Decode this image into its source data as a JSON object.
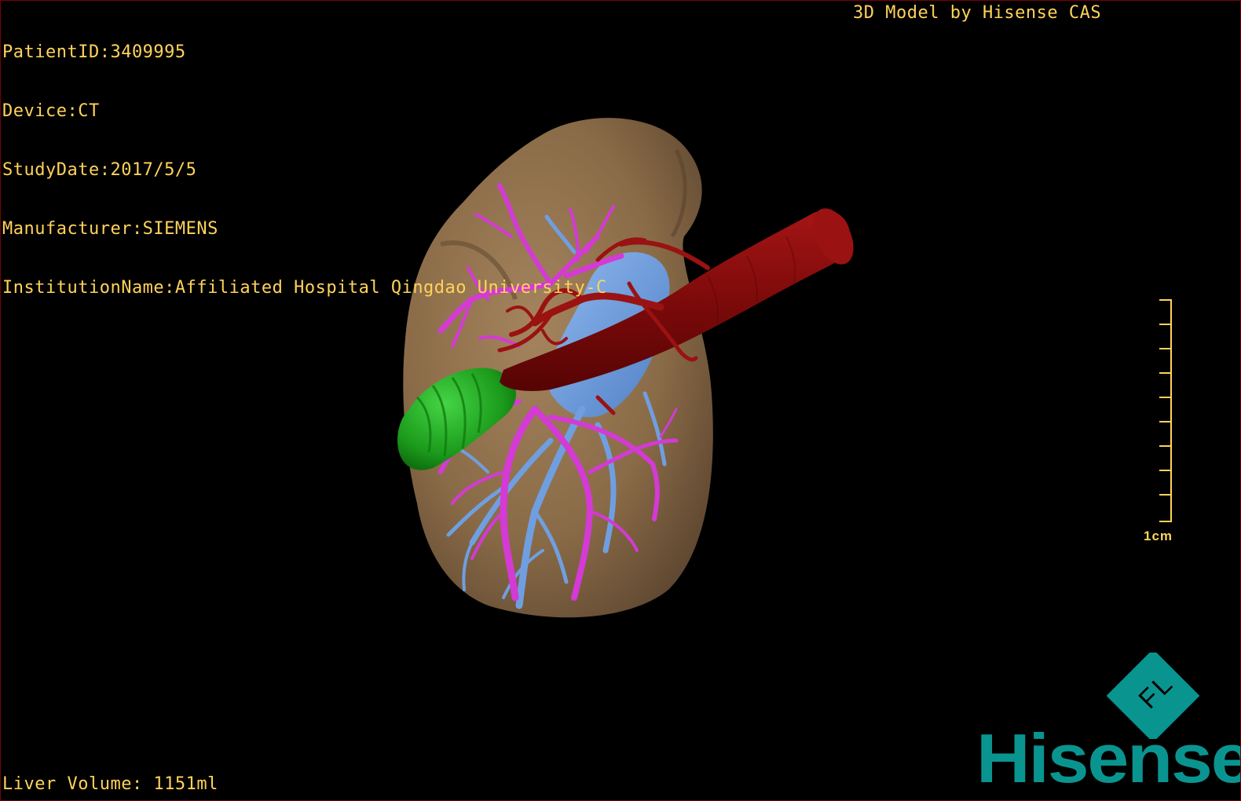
{
  "overlay": {
    "info_lines": [
      "PatientID:3409995",
      "Device:CT",
      "StudyDate:2017/5/5",
      "Manufacturer:SIEMENS",
      "InstitutionName:Affiliated Hospital Qingdao University-C"
    ],
    "model_credit": "3D Model by Hisense CAS",
    "liver_volume": "Liver Volume: 1151ml",
    "scale_label": "1cm"
  },
  "logo": {
    "mark_letters": "F L",
    "brand_name": "Hisense"
  },
  "colors": {
    "overlay_text": "#ffd35a",
    "liver": "#8a6b47",
    "portal_vein": "#d43ad4",
    "hepatic_vein": "#6f9fe0",
    "artery": "#8a0d0d",
    "gallbladder": "#1fa51f",
    "brand": "#0a9490"
  }
}
